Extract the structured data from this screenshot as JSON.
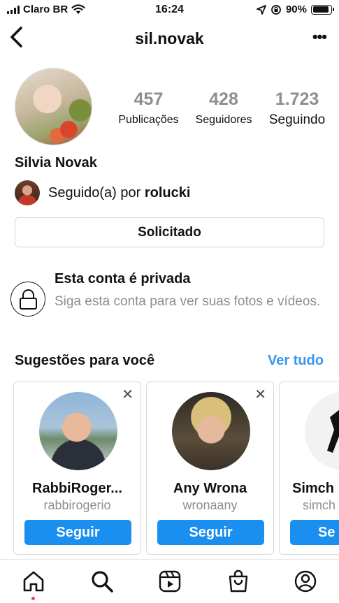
{
  "status_bar": {
    "carrier": "Claro BR",
    "time": "16:24",
    "battery": "90%",
    "battery_level": 0.9
  },
  "header": {
    "username": "sil.novak",
    "back_icon": "chevron-left-icon",
    "more_icon": "more-horizontal-icon"
  },
  "profile": {
    "name": "Silvia Novak",
    "stats": [
      {
        "value": "457",
        "label": "Publicações"
      },
      {
        "value": "428",
        "label": "Seguidores"
      },
      {
        "value": "1.723",
        "label": "Seguindo"
      }
    ],
    "followed_by_prefix": "Seguido(a) por",
    "followed_by_user": "rolucki",
    "request_button": "Solicitado"
  },
  "private_notice": {
    "title": "Esta conta é privada",
    "subtitle": "Siga esta conta para ver suas fotos e vídeos."
  },
  "suggestions": {
    "title": "Sugestões para você",
    "see_all": "Ver tudo",
    "close_icon": "close-icon",
    "items": [
      {
        "name": "RabbiRoger...",
        "username": "rabbirogerio",
        "button": "Seguir"
      },
      {
        "name": "Any Wrona",
        "username": "wronaany",
        "button": "Seguir"
      },
      {
        "name": "Simch",
        "username": "simch",
        "button": "Se"
      }
    ]
  },
  "tab_bar": {
    "tabs": [
      "home-icon",
      "search-icon",
      "reels-icon",
      "shop-icon",
      "profile-icon"
    ]
  },
  "colors": {
    "accent": "#3897f0",
    "follow_button": "#1a8ff0",
    "muted": "#8e8e8e",
    "notification_dot": "#ed4956"
  }
}
